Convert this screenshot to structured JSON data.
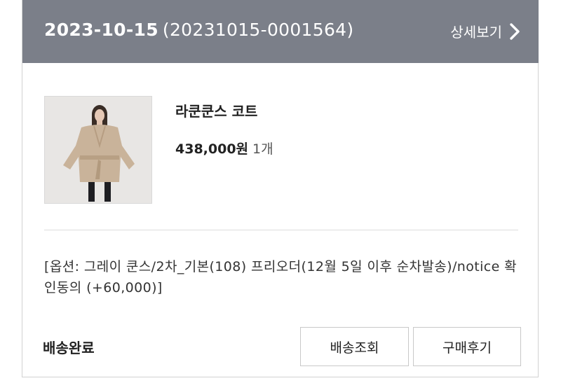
{
  "order": {
    "date": "2023-10-15",
    "number": "(20231015-0001564)",
    "detail_label": "상세보기"
  },
  "product": {
    "name": "라쿤쿤스 코트",
    "price": "438,000원",
    "quantity": "1개",
    "option": "[옵션: 그레이 쿤스/2차_기본(108) 프리오더(12월 5일 이후 순차발송)/notice 확인동의 (+60,000)]"
  },
  "status": {
    "label": "배송완료"
  },
  "actions": {
    "track_label": "배송조회",
    "review_label": "구매후기"
  },
  "colors": {
    "header_bg": "#7b7f89",
    "header_text": "#ffffff",
    "border": "#d2d2d2"
  },
  "icons": {
    "detail": "chevron-right-icon",
    "thumbnail": "product-photo-coat"
  }
}
